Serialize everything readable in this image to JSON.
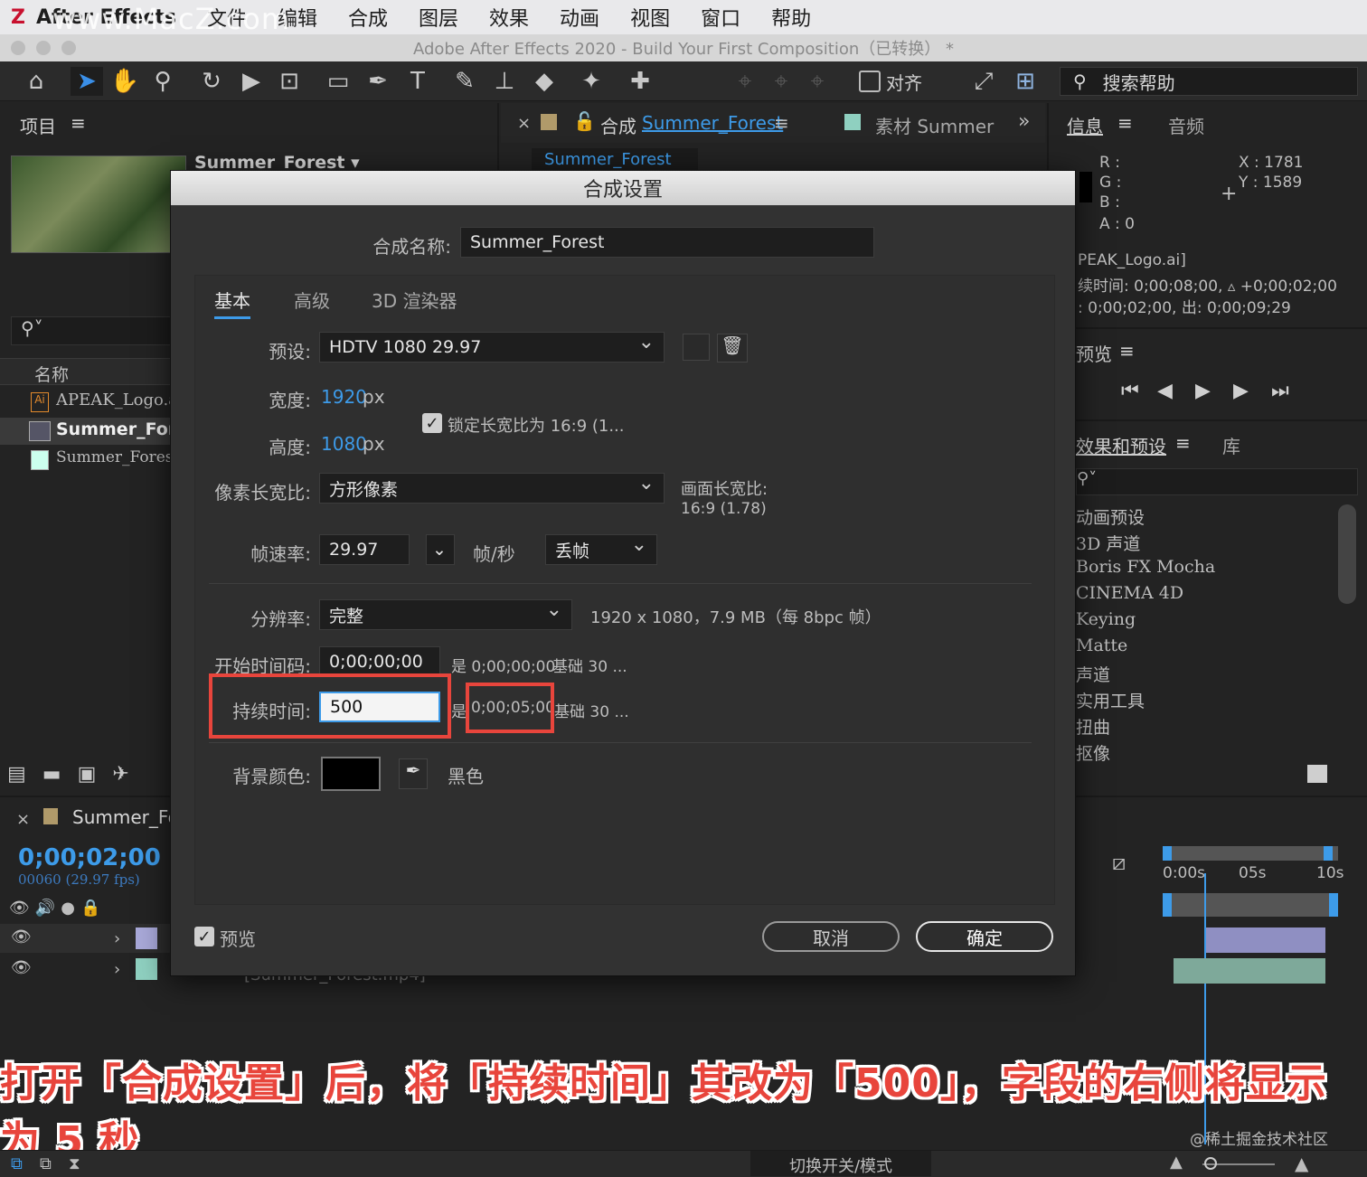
{
  "menubar": {
    "app": "After Effects",
    "items": [
      "文件",
      "编辑",
      "合成",
      "图层",
      "效果",
      "动画",
      "视图",
      "窗口",
      "帮助"
    ]
  },
  "watermark": "www.MacZ.com",
  "window_title": "Adobe After Effects 2020 - Build Your First Composition（已转换） *",
  "toolbar": {
    "align_label": "对齐",
    "search_help": "搜索帮助"
  },
  "project_panel": {
    "title": "项目",
    "selected_name": "Summer_Forest ▾",
    "column_name": "名称",
    "items": [
      "APEAK_Logo.ai",
      "Summer_Fore",
      "Summer_Forest."
    ]
  },
  "comp_panel": {
    "tab_comp_prefix": "合成",
    "tab_comp_name": "Summer_Forest",
    "tab_footage": "素材 Summer",
    "subtab": "Summer_Forest"
  },
  "info_panel": {
    "tab_info": "信息",
    "tab_audio": "音频",
    "r": "R :",
    "g": "G :",
    "b": "B :",
    "a": "A :  0",
    "x": "X : 1781",
    "y": "Y :  1589",
    "line1": "PEAK_Logo.ai]",
    "line2": "续时间: 0;00;08;00, ▵ +0;00;02;00",
    "line3": ": 0;00;02;00,  出: 0;00;09;29"
  },
  "preview_panel": {
    "title": "预览"
  },
  "effects_panel": {
    "title": "效果和预设",
    "tab_lib": "库",
    "items": [
      "动画预设",
      "3D 声道",
      "Boris FX Mocha",
      "CINEMA 4D",
      "Keying",
      "Matte",
      "声道",
      "实用工具",
      "扭曲",
      "抠像"
    ]
  },
  "timeline": {
    "comp_name": "Summer_Fo",
    "timecode": "0;00;02;00",
    "frames": "00060 (29.97 fps)",
    "ruler": [
      "0:00s",
      "05s",
      "10s"
    ],
    "layer_name": "[Summer_Forest.mp4]"
  },
  "dialog": {
    "title": "合成设置",
    "name_label": "合成名称:",
    "name_value": "Summer_Forest",
    "tabs": [
      "基本",
      "高级",
      "3D 渲染器"
    ],
    "preset_label": "预设:",
    "preset_value": "HDTV 1080 29.97",
    "width_label": "宽度:",
    "width_value": "1920",
    "height_label": "高度:",
    "height_value": "1080",
    "px_unit": "px",
    "lock_aspect": "锁定长宽比为 16:9 (1...",
    "pixel_aspect_label": "像素长宽比:",
    "pixel_aspect_value": "方形像素",
    "frame_aspect_label": "画面长宽比:",
    "frame_aspect_value": "16:9 (1.78)",
    "framerate_label": "帧速率:",
    "framerate_value": "29.97",
    "fps_unit": "帧/秒",
    "drop_frame": "丢帧",
    "resolution_label": "分辨率:",
    "resolution_value": "完整",
    "resolution_info": "1920 x 1080，7.9 MB（每 8bpc 帧）",
    "start_tc_label": "开始时间码:",
    "start_tc_value": "0;00;00;00",
    "start_tc_info_pre": "是 0;00;00;00",
    "start_tc_info_base": "基础 30 ...",
    "duration_label": "持续时间:",
    "duration_value": "500",
    "duration_info_pre": "是",
    "duration_info_value": "0;00;05;00",
    "duration_info_base": "基础 30 ...",
    "bg_label": "背景颜色:",
    "bg_value": "黑色",
    "preview_label": "预览",
    "cancel": "取消",
    "ok": "确定"
  },
  "caption": "打开「合成设置」后，将「持续时间」其改为「500」，字段的右侧将显示为 5 秒",
  "caption_credit": "@稀土掘金技术社区",
  "footer": {
    "toggle": "切换开关/模式"
  },
  "colors": {
    "accent": "#3d9be9",
    "highlight": "#e8453c"
  }
}
